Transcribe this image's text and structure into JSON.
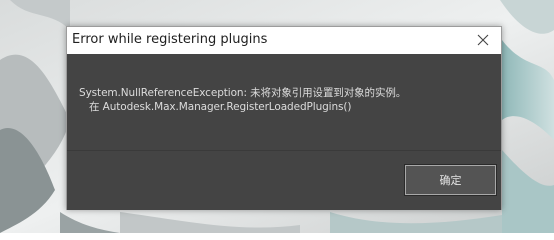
{
  "dialog": {
    "title": "Error while registering plugins",
    "message_line1": "System.NullReferenceException: 未将对象引用设置到对象的实例。",
    "message_line2": "在 Autodesk.Max.Manager.RegisterLoadedPlugins()",
    "ok_label": "确定",
    "close_icon": "close-icon"
  },
  "colors": {
    "content_bg": "#444444",
    "button_bg": "#545454",
    "title_bg": "#ffffff"
  }
}
